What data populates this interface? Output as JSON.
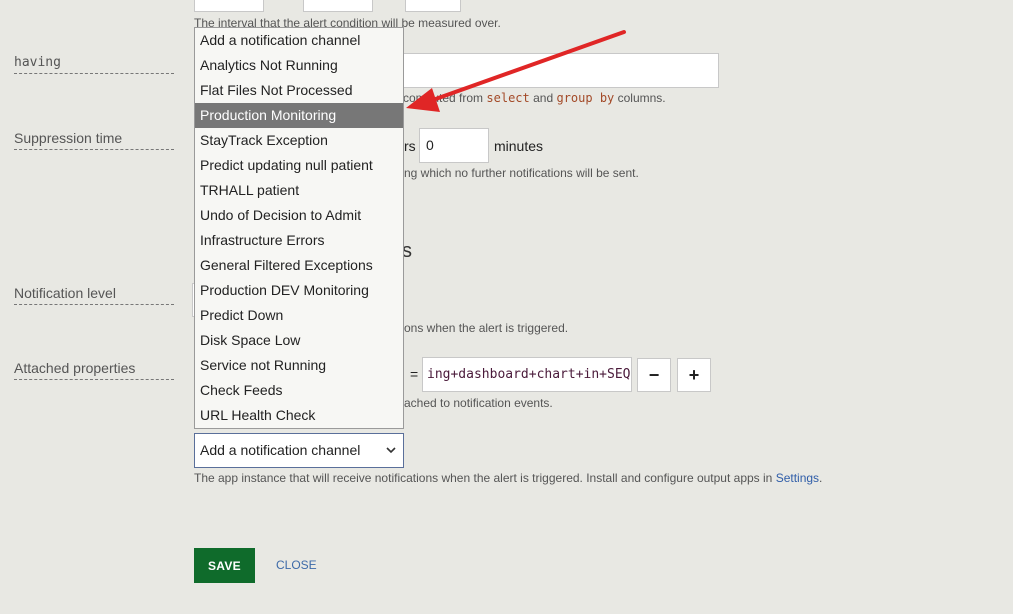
{
  "labels": {
    "having": "having",
    "suppression": "Suppression time",
    "notification_level": "Notification level",
    "attached_properties": "Attached properties"
  },
  "interval_help": "The interval that the alert condition will be measured over.",
  "having_help": {
    "prefix": "computed from",
    "code1": "select",
    "mid": "and",
    "code2": "group by",
    "suffix": "columns."
  },
  "suppression": {
    "unit_partial": "rs",
    "value": "0",
    "unit": "minutes",
    "help": "ng which no further notifications will be sent."
  },
  "section_heading_fragment": "s",
  "notification_level_help": "ons when the alert is triggered.",
  "attached": {
    "equals": "=",
    "value": "ing+dashboard+chart+in+SEQ",
    "minus": "−",
    "plus": "+",
    "help": "ached to notification events."
  },
  "dropdown": {
    "selected_index": 3,
    "options": [
      "Add a notification channel",
      "Analytics Not Running",
      "Flat Files Not Processed",
      "Production Monitoring",
      "StayTrack Exception",
      "Predict updating null patient",
      "TRHALL patient",
      "Undo of Decision to Admit",
      "Infrastructure Errors",
      "General Filtered Exceptions",
      "Production DEV Monitoring",
      "Predict Down",
      "Disk Space Low",
      "Service not Running",
      "Check Feeds",
      "URL Health Check"
    ]
  },
  "select": {
    "value": "Add a notification channel",
    "help_prefix": "The app instance that will receive notifications when the alert is triggered. Install and configure output apps in",
    "help_link": "Settings",
    "help_suffix": "."
  },
  "buttons": {
    "save": "SAVE",
    "close": "CLOSE"
  },
  "colors": {
    "background": "#e8e8e3",
    "save_button": "#0f6b2b",
    "arrow": "#e02626",
    "selected_option": "#777777",
    "link": "#2f5da8"
  }
}
